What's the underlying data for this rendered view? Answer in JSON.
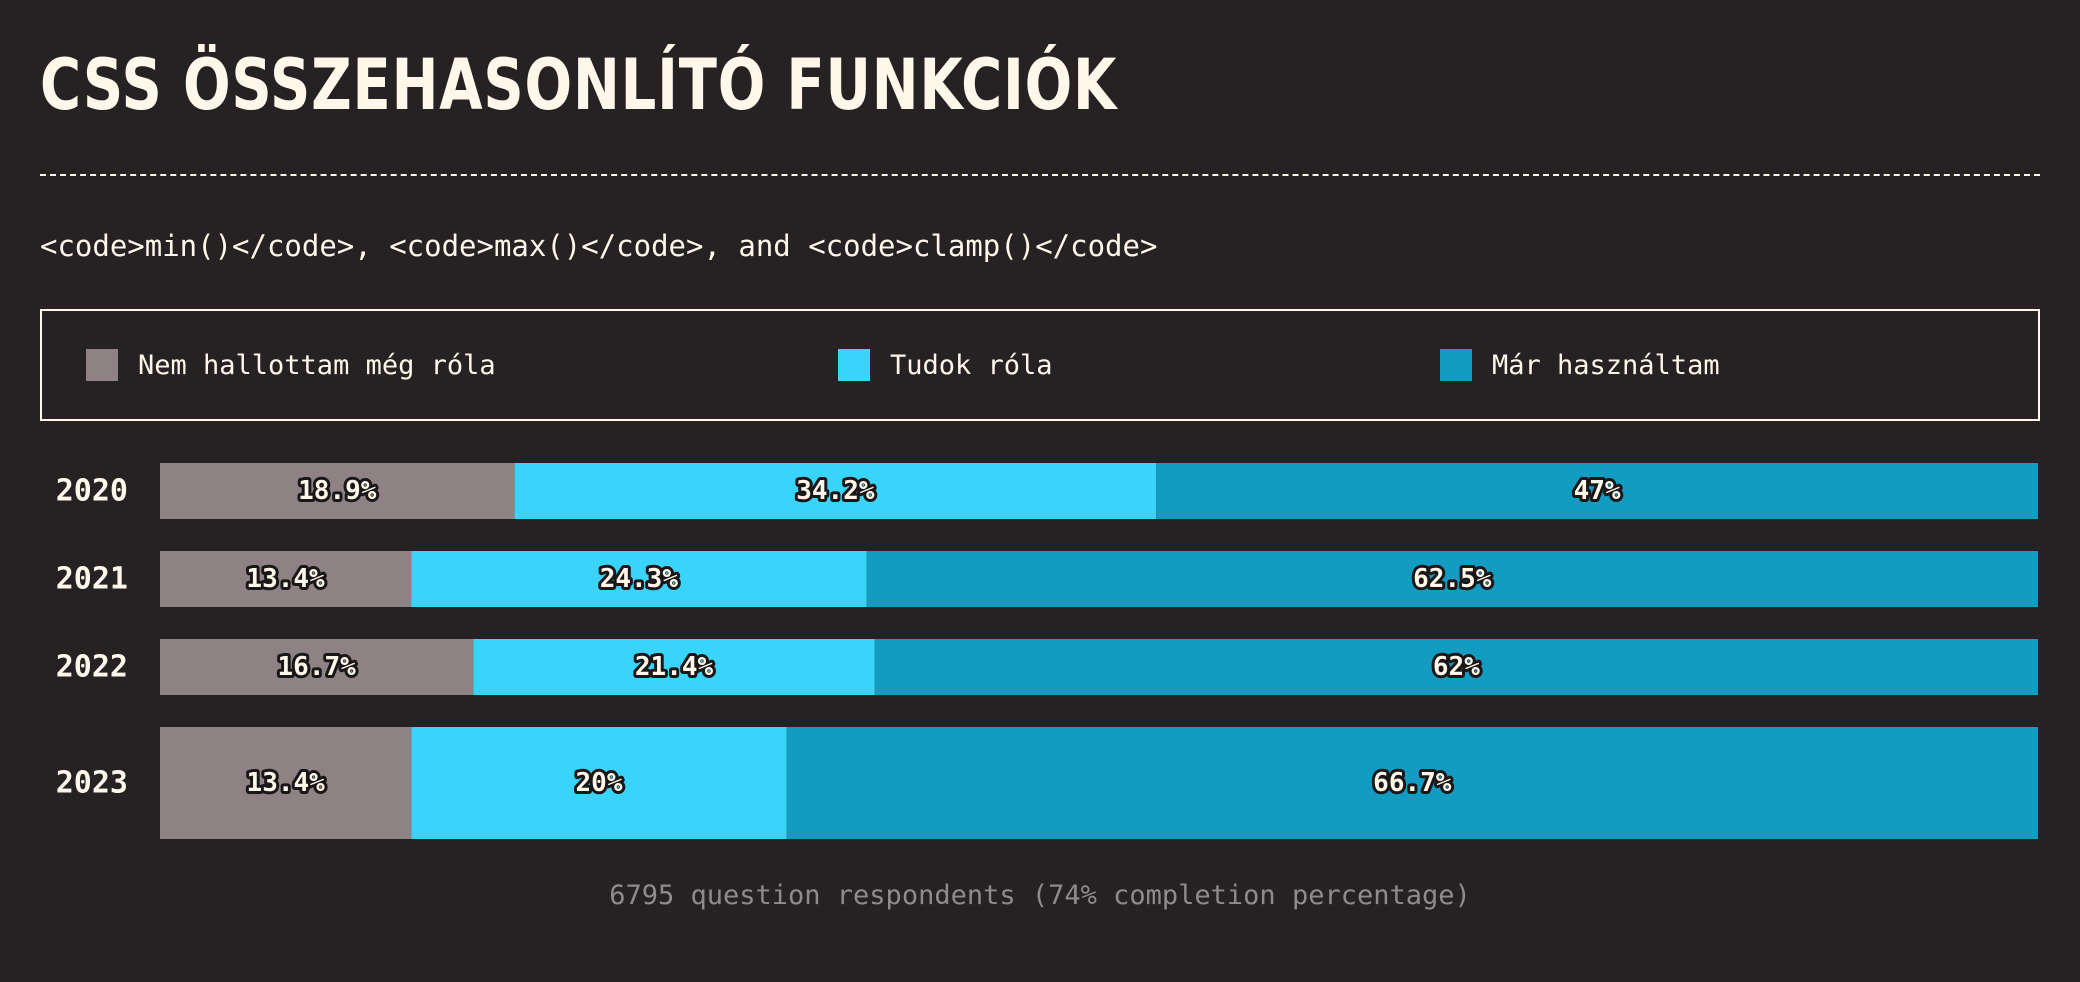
{
  "title": "CSS ÖSSZEHASONLÍTÓ FUNKCIÓK",
  "subtitle": "<code>min()</code>, <code>max()</code>, and <code>clamp()</code>",
  "legend": [
    {
      "label": "Nem hallottam még róla",
      "color": "#8e8285"
    },
    {
      "label": "Tudok róla",
      "color": "#3ad4fb"
    },
    {
      "label": "Már használtam",
      "color": "#149bc2"
    }
  ],
  "footnote": "6795 question respondents (74% completion percentage)",
  "chart_data": {
    "type": "bar",
    "orientation": "horizontal",
    "stacked": true,
    "normalized": true,
    "categories": [
      "2020",
      "2021",
      "2022",
      "2023"
    ],
    "series": [
      {
        "name": "Nem hallottam még róla",
        "color": "#8e8285",
        "values": [
          18.9,
          13.4,
          16.7,
          13.4
        ],
        "labels": [
          "18.9%",
          "13.4%",
          "16.7%",
          "13.4%"
        ]
      },
      {
        "name": "Tudok róla",
        "color": "#3ad4fb",
        "values": [
          34.2,
          24.3,
          21.4,
          20
        ],
        "labels": [
          "34.2%",
          "24.3%",
          "21.4%",
          "20%"
        ]
      },
      {
        "name": "Már használtam",
        "color": "#149bc2",
        "values": [
          47,
          62.5,
          62,
          66.7
        ],
        "labels": [
          "47%",
          "62.5%",
          "62%",
          "66.7%"
        ]
      }
    ],
    "xlim": [
      0,
      100
    ],
    "grid": false,
    "legend_position": "top"
  }
}
